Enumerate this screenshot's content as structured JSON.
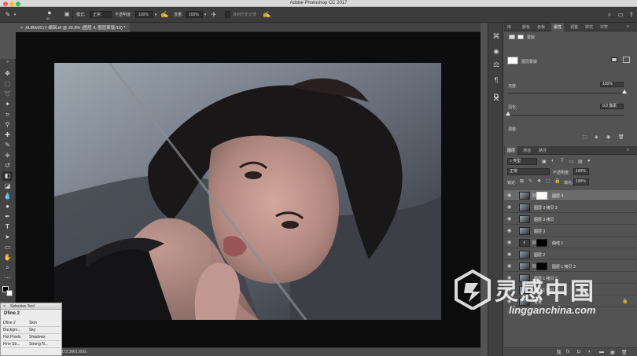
{
  "app": {
    "title": "Adobe Photoshop CC 2017"
  },
  "options_bar": {
    "brush_size": "60",
    "mode_label": "模式:",
    "mode_value": "正常",
    "opacity_label": "不透明度:",
    "opacity_value": "100%",
    "flow_label": "流量:",
    "flow_value": "100%",
    "history_label": "抹到历史记录"
  },
  "document": {
    "tab_title": "AUBA6617-编辑.tif @ 28.8% (图层 4, 图层蒙版/16)"
  },
  "status": {
    "text": "172.3M/1.69G"
  },
  "selective_tool": {
    "window_title": "Selective Tool",
    "heading": "Dfine 2",
    "rows": [
      {
        "left": "Dfine 2",
        "right": "Skin"
      },
      {
        "left": "Backgro...",
        "right": "Sky"
      },
      {
        "left": "Hot Pixels",
        "right": "Shadows"
      },
      {
        "left": "Fine Str...",
        "right": "Strong N..."
      }
    ]
  },
  "properties_panel": {
    "tabs": [
      "库",
      "颜色",
      "色板",
      "属性",
      "调整",
      "样式",
      "字符"
    ],
    "active_tab": "属性",
    "mask_label": "蒙版",
    "layer_mask_label": "图层蒙版",
    "density_label": "浓度:",
    "density_value": "100%",
    "density_level": 1.0,
    "feather_label": "羽化:",
    "feather_value": "0.0 像素",
    "feather_level": 0.0,
    "adjust_label": "调整:"
  },
  "layers_panel": {
    "tabs": [
      "图层",
      "通道",
      "路径"
    ],
    "active_tab": "图层",
    "filter_label": "类型",
    "blend_mode": "正常",
    "opacity_label": "不透明度:",
    "opacity_value": "100%",
    "lock_label": "锁定:",
    "fill_label": "填充:",
    "fill_value": "100%",
    "layers": [
      {
        "name": "图层 4",
        "selected": true,
        "mask": "white"
      },
      {
        "name": "图层 3 拷贝 2",
        "selected": false
      },
      {
        "name": "图层 3 拷贝",
        "selected": false
      },
      {
        "name": "图层 3",
        "selected": false
      },
      {
        "name": "曲线 1",
        "selected": false,
        "adjustment": true
      },
      {
        "name": "图层 2",
        "selected": false
      },
      {
        "name": "图层 1 拷贝 3",
        "selected": false,
        "mask": "black"
      },
      {
        "name": "图层 1 拷贝 2",
        "selected": false
      },
      {
        "name": "图层 1 拷贝",
        "selected": false
      },
      {
        "name": "背景",
        "selected": false
      }
    ]
  },
  "watermark": {
    "chinese": "灵感中国",
    "english": "lingganchina.com"
  },
  "colors": {
    "app_bg": "#535353",
    "canvas_bg": "#0d0d0d",
    "selected_layer": "#6b6b6b",
    "titlebar": "#d9d9d9"
  }
}
